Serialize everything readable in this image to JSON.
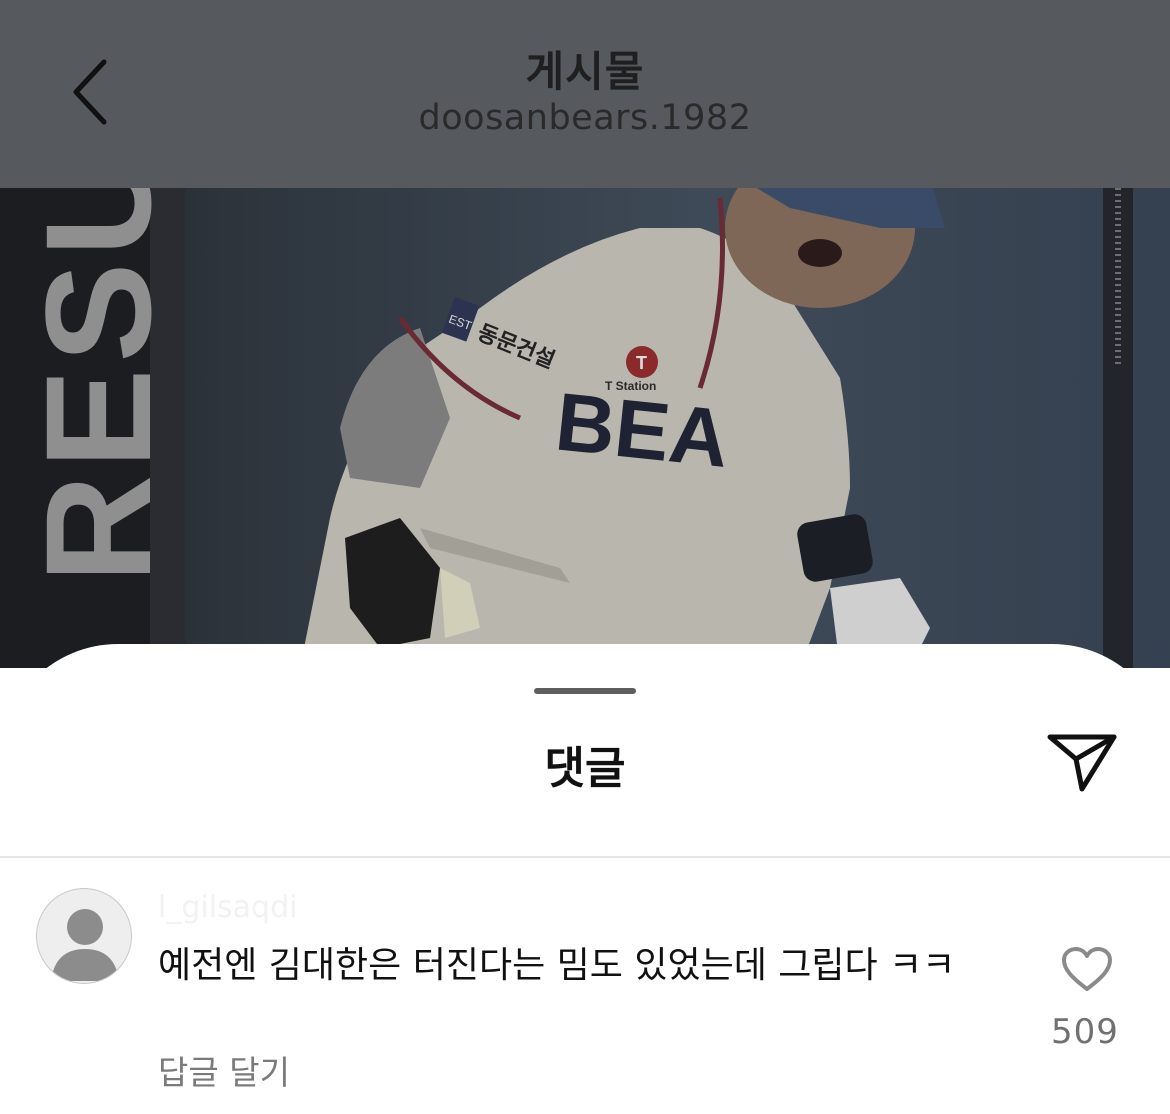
{
  "header": {
    "title": "게시물",
    "subtitle": "doosanbears.1982"
  },
  "photo": {
    "side_text": "RESU",
    "jersey_text": "BEA",
    "patch_text": "동문건설",
    "patch_tag": "EST",
    "sponsor_text": "T Station",
    "sponsor_letter": "T"
  },
  "comments_sheet": {
    "title": "댓글",
    "comment": {
      "username": "l_gilsaqdi",
      "text": "예전엔 김대한은 터진다는 밈도 있었는데 그립다 ㅋㅋ",
      "reply_label": "답글 달기",
      "like_count": "509"
    }
  },
  "colors": {
    "header_bg": "#565a5e",
    "sheet_bg": "#ffffff",
    "muted_text": "#7a7a7a"
  },
  "icons": {
    "back": "chevron-left-icon",
    "send": "paper-plane-icon",
    "like": "heart-icon",
    "avatar": "default-avatar-icon"
  }
}
